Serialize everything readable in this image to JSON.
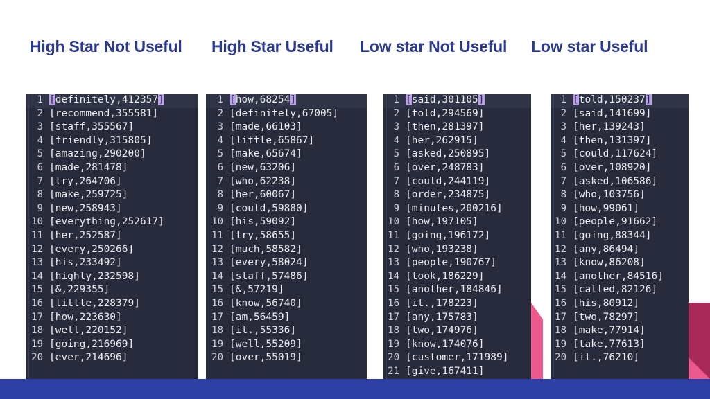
{
  "slide": {
    "background_color": "#ffffff",
    "heading_color": "#2c3a8c",
    "band_color": "#2e3fa3",
    "panel_bg": "#272b3b",
    "highlight_color": "#b9a2e8",
    "accent_pink": "#ec5a8d",
    "accent_maroon": "#a62a55"
  },
  "columns": [
    {
      "heading": "High Star Not Useful",
      "rows": [
        {
          "n": "1",
          "open": "[",
          "body": "definitely,412357",
          "close": "]",
          "highlight": true
        },
        {
          "n": "2",
          "open": "[",
          "body": "recommend,355581",
          "close": "]",
          "highlight": false
        },
        {
          "n": "3",
          "open": "[",
          "body": "staff,355567",
          "close": "]",
          "highlight": false
        },
        {
          "n": "4",
          "open": "[",
          "body": "friendly,315805",
          "close": "]",
          "highlight": false
        },
        {
          "n": "5",
          "open": "[",
          "body": "amazing,290200",
          "close": "]",
          "highlight": false
        },
        {
          "n": "6",
          "open": "[",
          "body": "made,281478",
          "close": "]",
          "highlight": false
        },
        {
          "n": "7",
          "open": "[",
          "body": "try,264706",
          "close": "]",
          "highlight": false
        },
        {
          "n": "8",
          "open": "[",
          "body": "make,259725",
          "close": "]",
          "highlight": false
        },
        {
          "n": "9",
          "open": "[",
          "body": "new,258943",
          "close": "]",
          "highlight": false
        },
        {
          "n": "10",
          "open": "[",
          "body": "everything,252617",
          "close": "]",
          "highlight": false
        },
        {
          "n": "11",
          "open": "[",
          "body": "her,252587",
          "close": "]",
          "highlight": false
        },
        {
          "n": "12",
          "open": "[",
          "body": "every,250266",
          "close": "]",
          "highlight": false
        },
        {
          "n": "13",
          "open": "[",
          "body": "his,233492",
          "close": "]",
          "highlight": false
        },
        {
          "n": "14",
          "open": "[",
          "body": "highly,232598",
          "close": "]",
          "highlight": false
        },
        {
          "n": "15",
          "open": "[",
          "body": "&,229355",
          "close": "]",
          "highlight": false
        },
        {
          "n": "16",
          "open": "[",
          "body": "little,228379",
          "close": "]",
          "highlight": false
        },
        {
          "n": "17",
          "open": "[",
          "body": "how,223630",
          "close": "]",
          "highlight": false
        },
        {
          "n": "18",
          "open": "[",
          "body": "well,220152",
          "close": "]",
          "highlight": false
        },
        {
          "n": "19",
          "open": "[",
          "body": "going,216969",
          "close": "]",
          "highlight": false
        },
        {
          "n": "20",
          "open": "[",
          "body": "ever,214696",
          "close": "]",
          "highlight": false
        }
      ]
    },
    {
      "heading": "High Star Useful",
      "rows": [
        {
          "n": "1",
          "open": "[",
          "body": "how,68254",
          "close": "]",
          "highlight": true
        },
        {
          "n": "2",
          "open": "[",
          "body": "definitely,67005",
          "close": "]",
          "highlight": false
        },
        {
          "n": "3",
          "open": "[",
          "body": "made,66103",
          "close": "]",
          "highlight": false
        },
        {
          "n": "4",
          "open": "[",
          "body": "little,65867",
          "close": "]",
          "highlight": false
        },
        {
          "n": "5",
          "open": "[",
          "body": "make,65674",
          "close": "]",
          "highlight": false
        },
        {
          "n": "6",
          "open": "[",
          "body": "new,63206",
          "close": "]",
          "highlight": false
        },
        {
          "n": "7",
          "open": "[",
          "body": "who,62238",
          "close": "]",
          "highlight": false
        },
        {
          "n": "8",
          "open": "[",
          "body": "her,60067",
          "close": "]",
          "highlight": false
        },
        {
          "n": "9",
          "open": "[",
          "body": "could,59880",
          "close": "]",
          "highlight": false
        },
        {
          "n": "10",
          "open": "[",
          "body": "his,59092",
          "close": "]",
          "highlight": false
        },
        {
          "n": "11",
          "open": "[",
          "body": "try,58655",
          "close": "]",
          "highlight": false
        },
        {
          "n": "12",
          "open": "[",
          "body": "much,58582",
          "close": "]",
          "highlight": false
        },
        {
          "n": "13",
          "open": "[",
          "body": "every,58024",
          "close": "]",
          "highlight": false
        },
        {
          "n": "14",
          "open": "[",
          "body": "staff,57486",
          "close": "]",
          "highlight": false
        },
        {
          "n": "15",
          "open": "[",
          "body": "&,57219",
          "close": "]",
          "highlight": false
        },
        {
          "n": "16",
          "open": "[",
          "body": "know,56740",
          "close": "]",
          "highlight": false
        },
        {
          "n": "17",
          "open": "[",
          "body": "am,56459",
          "close": "]",
          "highlight": false
        },
        {
          "n": "18",
          "open": "[",
          "body": "it.,55336",
          "close": "]",
          "highlight": false
        },
        {
          "n": "19",
          "open": "[",
          "body": "well,55209",
          "close": "]",
          "highlight": false
        },
        {
          "n": "20",
          "open": "[",
          "body": "over,55019",
          "close": "]",
          "highlight": false
        }
      ]
    },
    {
      "heading": "Low star Not Useful",
      "rows": [
        {
          "n": "1",
          "open": "[",
          "body": "said,301105",
          "close": "]",
          "highlight": true
        },
        {
          "n": "2",
          "open": "[",
          "body": "told,294569",
          "close": "]",
          "highlight": false
        },
        {
          "n": "3",
          "open": "[",
          "body": "then,281397",
          "close": "]",
          "highlight": false
        },
        {
          "n": "4",
          "open": "[",
          "body": "her,262915",
          "close": "]",
          "highlight": false
        },
        {
          "n": "5",
          "open": "[",
          "body": "asked,250895",
          "close": "]",
          "highlight": false
        },
        {
          "n": "6",
          "open": "[",
          "body": "over,248783",
          "close": "]",
          "highlight": false
        },
        {
          "n": "7",
          "open": "[",
          "body": "could,244119",
          "close": "]",
          "highlight": false
        },
        {
          "n": "8",
          "open": "[",
          "body": "order,234875",
          "close": "]",
          "highlight": false
        },
        {
          "n": "9",
          "open": "[",
          "body": "minutes,200216",
          "close": "]",
          "highlight": false
        },
        {
          "n": "10",
          "open": "[",
          "body": "how,197105",
          "close": "]",
          "highlight": false
        },
        {
          "n": "11",
          "open": "[",
          "body": "going,196172",
          "close": "]",
          "highlight": false
        },
        {
          "n": "12",
          "open": "[",
          "body": "who,193238",
          "close": "]",
          "highlight": false
        },
        {
          "n": "13",
          "open": "[",
          "body": "people,190767",
          "close": "]",
          "highlight": false
        },
        {
          "n": "14",
          "open": "[",
          "body": "took,186229",
          "close": "]",
          "highlight": false
        },
        {
          "n": "15",
          "open": "[",
          "body": "another,184846",
          "close": "]",
          "highlight": false
        },
        {
          "n": "16",
          "open": "[",
          "body": "it.,178223",
          "close": "]",
          "highlight": false
        },
        {
          "n": "17",
          "open": "[",
          "body": "any,175783",
          "close": "]",
          "highlight": false
        },
        {
          "n": "18",
          "open": "[",
          "body": "two,174976",
          "close": "]",
          "highlight": false
        },
        {
          "n": "19",
          "open": "[",
          "body": "know,174076",
          "close": "]",
          "highlight": false
        },
        {
          "n": "20",
          "open": "[",
          "body": "customer,171989",
          "close": "]",
          "highlight": false
        },
        {
          "n": "21",
          "open": "[",
          "body": "give,167411",
          "close": "]",
          "highlight": false
        }
      ]
    },
    {
      "heading": "Low star Useful",
      "rows": [
        {
          "n": "1",
          "open": "[",
          "body": "told,150237",
          "close": "]",
          "highlight": true
        },
        {
          "n": "2",
          "open": "[",
          "body": "said,141699",
          "close": "]",
          "highlight": false
        },
        {
          "n": "3",
          "open": "[",
          "body": "her,139243",
          "close": "]",
          "highlight": false
        },
        {
          "n": "4",
          "open": "[",
          "body": "then,131397",
          "close": "]",
          "highlight": false
        },
        {
          "n": "5",
          "open": "[",
          "body": "could,117624",
          "close": "]",
          "highlight": false
        },
        {
          "n": "6",
          "open": "[",
          "body": "over,108920",
          "close": "]",
          "highlight": false
        },
        {
          "n": "7",
          "open": "[",
          "body": "asked,106586",
          "close": "]",
          "highlight": false
        },
        {
          "n": "8",
          "open": "[",
          "body": "who,103756",
          "close": "]",
          "highlight": false
        },
        {
          "n": "9",
          "open": "[",
          "body": "how,99061",
          "close": "]",
          "highlight": false
        },
        {
          "n": "10",
          "open": "[",
          "body": "people,91662",
          "close": "]",
          "highlight": false
        },
        {
          "n": "11",
          "open": "[",
          "body": "going,88344",
          "close": "]",
          "highlight": false
        },
        {
          "n": "12",
          "open": "[",
          "body": "any,86494",
          "close": "]",
          "highlight": false
        },
        {
          "n": "13",
          "open": "[",
          "body": "know,86208",
          "close": "]",
          "highlight": false
        },
        {
          "n": "14",
          "open": "[",
          "body": "another,84516",
          "close": "]",
          "highlight": false
        },
        {
          "n": "15",
          "open": "[",
          "body": "called,82126",
          "close": "]",
          "highlight": false
        },
        {
          "n": "16",
          "open": "[",
          "body": "his,80912",
          "close": "]",
          "highlight": false
        },
        {
          "n": "17",
          "open": "[",
          "body": "two,78297",
          "close": "]",
          "highlight": false
        },
        {
          "n": "18",
          "open": "[",
          "body": "make,77914",
          "close": "]",
          "highlight": false
        },
        {
          "n": "19",
          "open": "[",
          "body": "take,77613",
          "close": "]",
          "highlight": false
        },
        {
          "n": "20",
          "open": "[",
          "body": "it.,76210",
          "close": "]",
          "highlight": false
        }
      ]
    }
  ]
}
